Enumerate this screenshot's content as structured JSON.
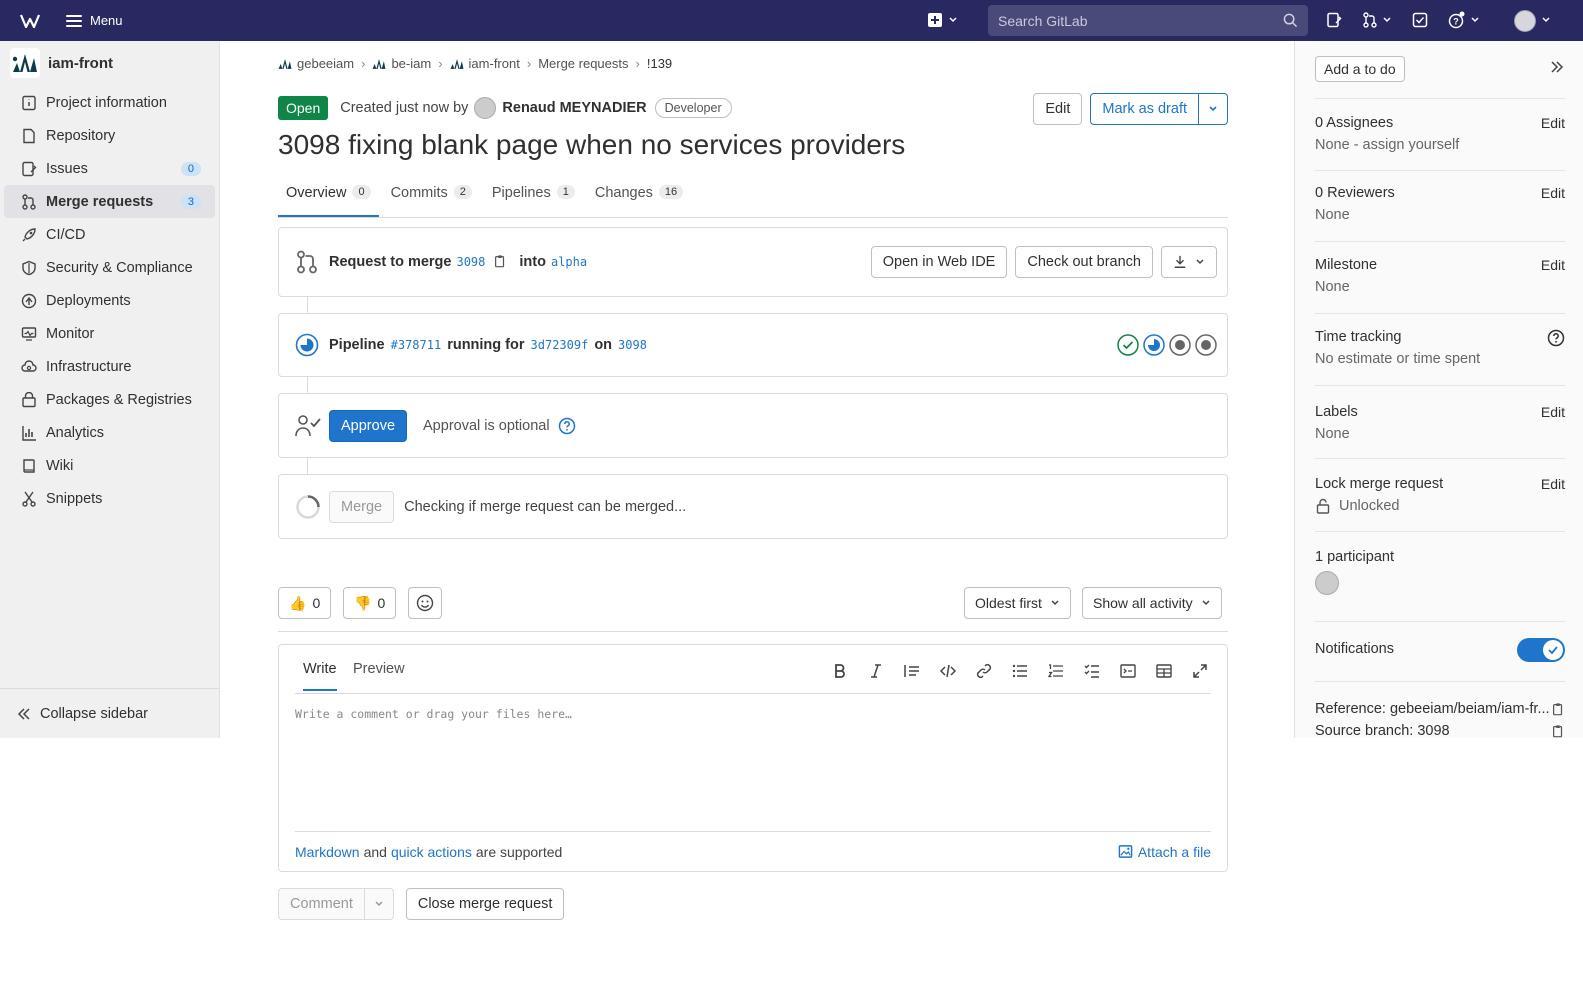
{
  "topbar": {
    "menu_label": "Menu",
    "search_placeholder": "Search GitLab"
  },
  "sidebar": {
    "project_name": "iam-front",
    "items": [
      {
        "label": "Project information",
        "icon": "info-icon"
      },
      {
        "label": "Repository",
        "icon": "doc-icon"
      },
      {
        "label": "Issues",
        "icon": "issues-icon",
        "badge": "0"
      },
      {
        "label": "Merge requests",
        "icon": "merge-request-icon",
        "badge": "3",
        "active": true
      },
      {
        "label": "CI/CD",
        "icon": "rocket-icon"
      },
      {
        "label": "Security & Compliance",
        "icon": "shield-icon"
      },
      {
        "label": "Deployments",
        "icon": "deployments-icon"
      },
      {
        "label": "Monitor",
        "icon": "monitor-icon"
      },
      {
        "label": "Infrastructure",
        "icon": "cloud-gear-icon"
      },
      {
        "label": "Packages & Registries",
        "icon": "package-icon"
      },
      {
        "label": "Analytics",
        "icon": "chart-icon"
      },
      {
        "label": "Wiki",
        "icon": "book-icon"
      },
      {
        "label": "Snippets",
        "icon": "scissors-icon"
      }
    ],
    "collapse_label": "Collapse sidebar"
  },
  "breadcrumbs": [
    "gebeeiam",
    "be-iam",
    "iam-front",
    "Merge requests",
    "!139"
  ],
  "mr": {
    "status": "Open",
    "created_text": "Created just now by",
    "author": "Renaud MEYNADIER",
    "role": "Developer",
    "edit_label": "Edit",
    "draft_label": "Mark as draft",
    "title": "3098 fixing blank page when no services providers",
    "tabs": [
      {
        "label": "Overview",
        "count": "0"
      },
      {
        "label": "Commits",
        "count": "2"
      },
      {
        "label": "Pipelines",
        "count": "1"
      },
      {
        "label": "Changes",
        "count": "16"
      }
    ]
  },
  "merge_info": {
    "request_label": "Request to merge",
    "source_branch": "3098",
    "into_label": "into",
    "target_branch": "alpha",
    "web_ide_label": "Open in Web IDE",
    "checkout_label": "Check out branch"
  },
  "pipeline": {
    "label": "Pipeline",
    "id": "#378711",
    "status_text": "running for",
    "commit": "3d72309f",
    "on_label": "on",
    "branch": "3098",
    "stages": [
      "success",
      "running",
      "pending",
      "pending"
    ]
  },
  "approval": {
    "approve_label": "Approve",
    "optional_text": "Approval is optional"
  },
  "merge": {
    "merge_label": "Merge",
    "checking_text": "Checking if merge request can be merged..."
  },
  "reactions": {
    "thumbs_up": "0",
    "thumbs_down": "0",
    "sort_label": "Oldest first",
    "filter_label": "Show all activity"
  },
  "editor": {
    "write_tab": "Write",
    "preview_tab": "Preview",
    "placeholder": "Write a comment or drag your files here…",
    "markdown_link": "Markdown",
    "and_text": "and",
    "quick_actions_link": "quick actions",
    "supported_text": "are supported",
    "attach_label": "Attach a file"
  },
  "actions": {
    "comment_label": "Comment",
    "close_label": "Close merge request"
  },
  "right_sidebar": {
    "todo_label": "Add a to do",
    "assignees_label": "0 Assignees",
    "assignees_value": "None - assign yourself",
    "reviewers_label": "0 Reviewers",
    "reviewers_value": "None",
    "milestone_label": "Milestone",
    "milestone_value": "None",
    "time_label": "Time tracking",
    "time_value": "No estimate or time spent",
    "labels_label": "Labels",
    "labels_value": "None",
    "lock_label": "Lock merge request",
    "lock_value": "Unlocked",
    "participants_label": "1 participant",
    "notifications_label": "Notifications",
    "reference_label": "Reference: gebeeiam/beiam/iam-fr...",
    "source_branch_label": "Source branch: 3098",
    "edit_label": "Edit"
  },
  "colors": {
    "topbar": "#292961",
    "primary": "#1f75cb",
    "success": "#108548"
  }
}
